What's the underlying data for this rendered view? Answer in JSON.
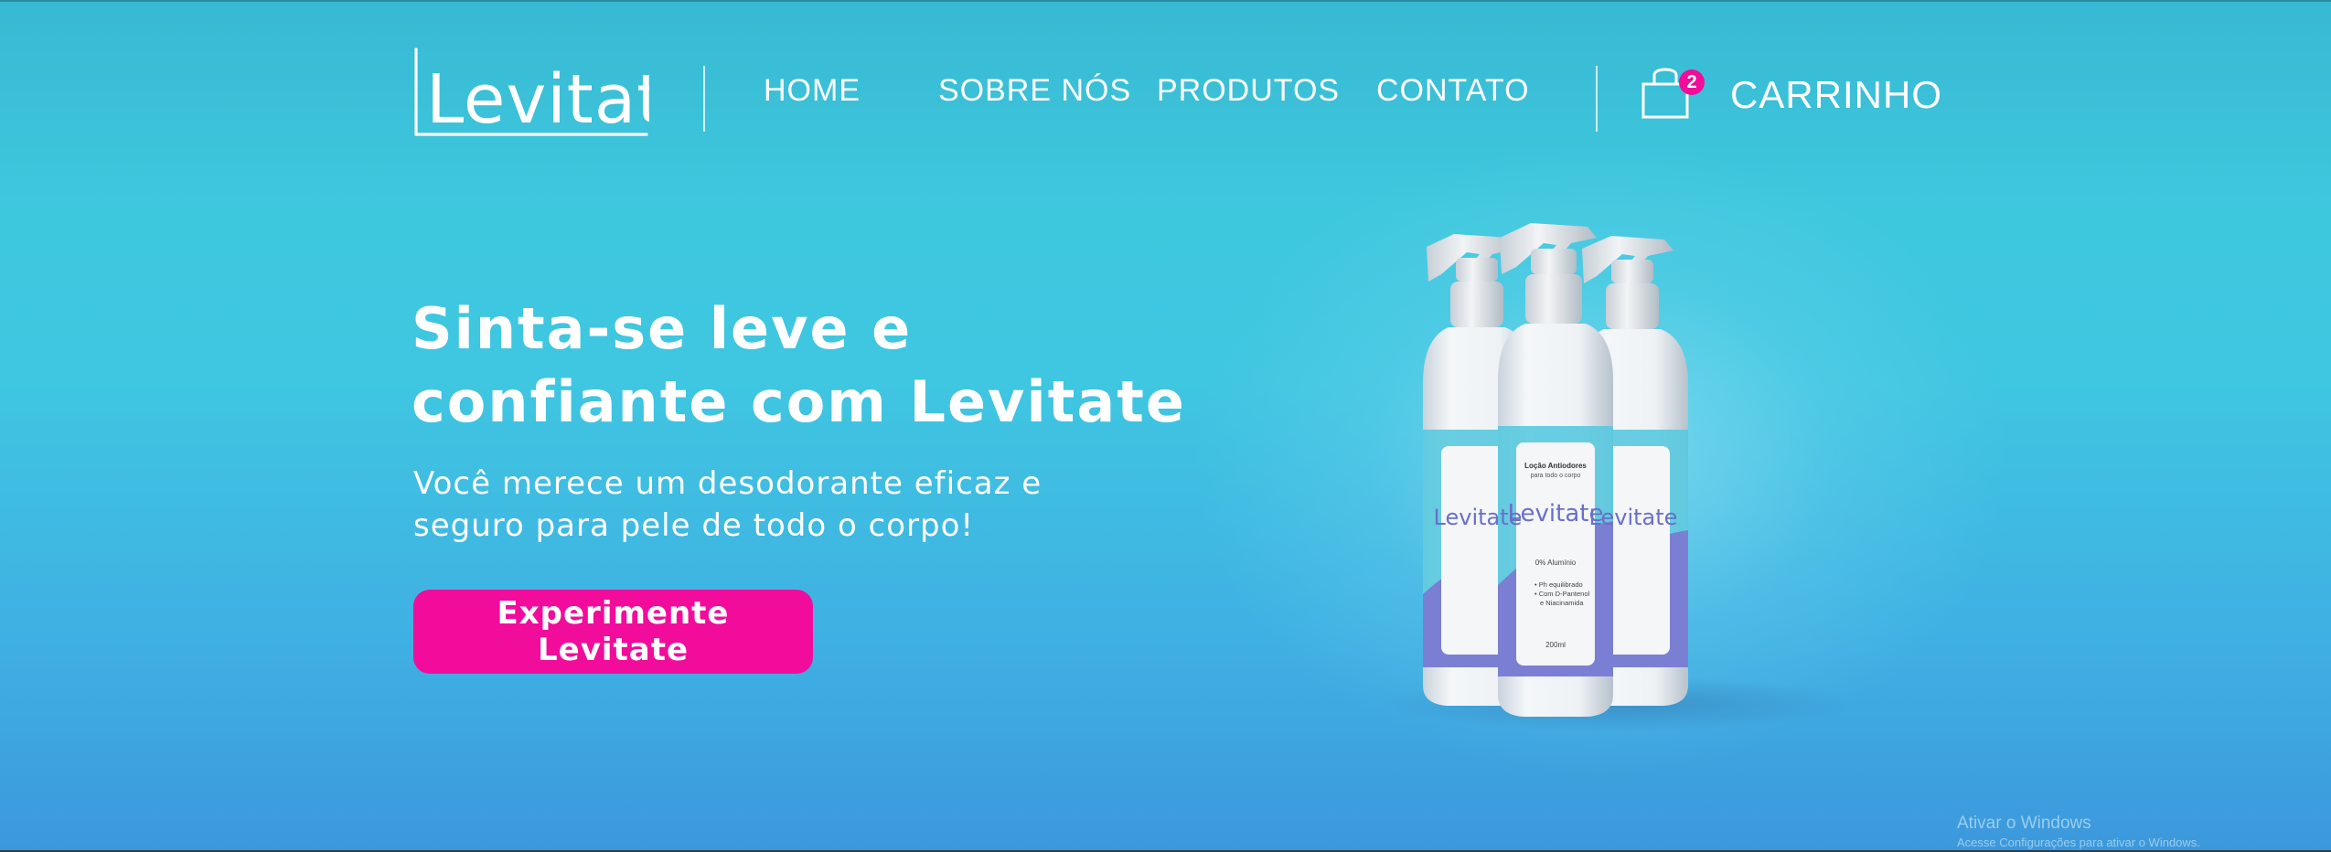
{
  "brand": {
    "logo_text": "Levitate",
    "icon": "levitate-logo"
  },
  "nav": {
    "items": [
      {
        "label": "HOME"
      },
      {
        "label": "SOBRE NÓS"
      },
      {
        "label": "PRODUTOS"
      },
      {
        "label": "CONTATO"
      }
    ]
  },
  "cart": {
    "label": "CARRINHO",
    "count": "2",
    "icon": "shopping-bag-icon"
  },
  "hero": {
    "headline_line1": "Sinta-se leve e",
    "headline_line2": "confiante com Levitate",
    "sub_line1": "Você merece um desodorante eficaz e",
    "sub_line2": "seguro para pele de todo o corpo!",
    "cta_label": "Experimente Levitate"
  },
  "product_label": {
    "title": "Loção Antiodores",
    "subtitle": "para todo o corpo",
    "brand": "Levitate",
    "claim": "0% Alumínio",
    "features": [
      "• Ph equilibrado",
      "• Com D-Pantenol",
      "e Niacinamida"
    ],
    "volume": "200ml"
  },
  "windows_watermark": {
    "line1": "Ativar o Windows",
    "line2": "Acesse Configurações para ativar o Windows."
  },
  "colors": {
    "accent": "#f20c9c",
    "background_top": "#38b9d3",
    "background_bottom": "#3c98dc",
    "label_violet": "#7b7fd3"
  }
}
